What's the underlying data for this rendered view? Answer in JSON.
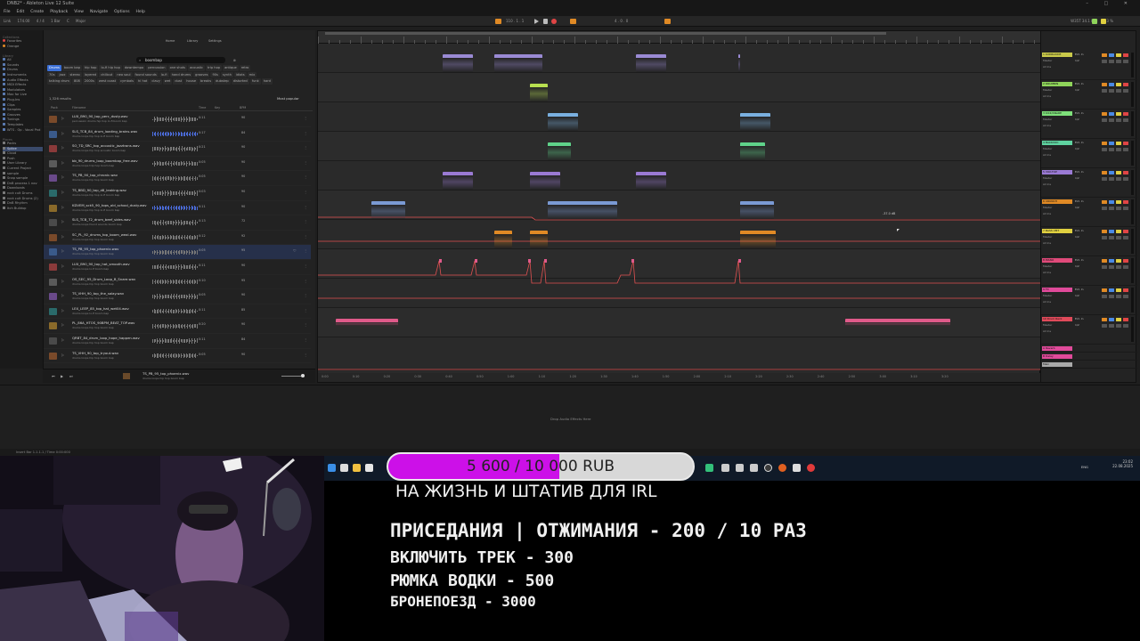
{
  "window": {
    "title": "DNB2* - Ableton Live 12 Suite",
    "controls": [
      "–",
      "□",
      "✕"
    ]
  },
  "menu": [
    "File",
    "Edit",
    "Create",
    "Playback",
    "View",
    "Navigate",
    "Options",
    "Help"
  ],
  "controlbar": {
    "link": "Link",
    "tempo": "174.00",
    "signature": "4 / 4",
    "quantize": "1 Bar",
    "key": "C",
    "scale": "Major",
    "position": "110 . 1 . 1",
    "loop_len": "4 . 0 . 0",
    "cpu": "W35T  34.1 kHz",
    "cpu_pct": "13 %"
  },
  "leftnav": {
    "collections_head": "Collections",
    "collections": [
      {
        "label": "Favorites",
        "color": "#e04545"
      },
      {
        "label": "Orange",
        "color": "#e08a25"
      }
    ],
    "library_head": "Library",
    "library": [
      "All",
      "Sounds",
      "Drums",
      "Instruments",
      "Audio Effects",
      "MIDI Effects",
      "Modulators",
      "Max for Live",
      "Plug-Ins",
      "Clips",
      "Samples",
      "Grooves",
      "Tunings",
      "Templates",
      "WTS . Op . Vocal Pnd"
    ],
    "places_head": "Places",
    "places": [
      "Packs",
      "Splice",
      "Cloud",
      "Push",
      "User Library",
      "Current Project",
      "sample",
      "Snap sample",
      "DnB process 1 nov",
      "Downloads",
      "rock cult Drums",
      "rock cult Drums (2)",
      "DnB Rhythm",
      "Itch Buildup"
    ],
    "selected_place": "Splice"
  },
  "browser": {
    "icons": [
      "Home",
      "Library",
      "Settings"
    ],
    "search_value": "boombap",
    "tags_row1": [
      "Drums",
      "boom bap",
      "hip hop",
      "lo-fi hip hop",
      "downtempo",
      "percussion",
      "one shots",
      "acoustic",
      "trip hop",
      "antique",
      "retro"
    ],
    "tags_row2": [
      "70s",
      "jazz",
      "stereo",
      "layered",
      "chillout",
      "neo soul",
      "found sounds",
      "lo-fi",
      "hand drums",
      "grooves",
      "90s",
      "synth",
      "idiots",
      "mix"
    ],
    "tags_row3": [
      "talking drum",
      "808",
      "2000s",
      "west coast",
      "cymbals",
      "hi hat",
      "clavy",
      "wet",
      "dust",
      "house",
      "breaks",
      "dubstep",
      "distorted",
      "funk",
      "hard"
    ],
    "selected_tag": "Drums",
    "results": "1,326 results",
    "sort": "Most popular",
    "columns": {
      "pack": "Pack",
      "filename": "Filename",
      "time": "Time",
      "key": "Key",
      "bpm": "BPM"
    },
    "files": [
      {
        "name": "LUX_B90_90_top_perc_dusty.wav",
        "tags": "percussion  drums  hip hop  lo-fi  boom bap",
        "time": "0:11",
        "bpm": "90"
      },
      {
        "name": "SLS_TCB_84_drum_loading_brains.wav",
        "tags": "drums  loops  hip hop  lo-fi  boom bap",
        "time": "0:17",
        "bpm": "84"
      },
      {
        "name": "SO_TD_SRC_top_acoustic_jazztrans.wav",
        "tags": "drums  loops  hip hop  acoustic  boom bap",
        "time": "0:21",
        "bpm": "90"
      },
      {
        "name": "bb_90_drums_loop_boombap_free.wav",
        "tags": "drums  loops  trip hop  boom bap",
        "time": "0:05",
        "bpm": "90"
      },
      {
        "name": "TS_PB_90_top_chronic.wav",
        "tags": "drums  loops  hip hop  boom bap",
        "time": "0:05",
        "bpm": "90"
      },
      {
        "name": "TS_BBD_90_top_d8_leaking.wav",
        "tags": "drums  loops  hip hop  lo-fi  boom bap",
        "time": "0:03",
        "bpm": "90"
      },
      {
        "name": "KDVEM_sck5_90_tops_old_school_dusty.wav",
        "tags": "drums  loops  hip hop  lo-fi  boom bap",
        "time": "0:11",
        "bpm": "90"
      },
      {
        "name": "SLS_TCB_72_drum_beef_sides.wav",
        "tags": "drums  loops  found sounds  boom bap",
        "time": "0:13",
        "bpm": "72"
      },
      {
        "name": "SC_PL_92_drums_top_boom_weal.wav",
        "tags": "drums  loops  hip hop  boom bap",
        "time": "0:12",
        "bpm": "92"
      },
      {
        "name": "TS_PB_95_top_phoenix.wav",
        "tags": "drums  loops  hip hop  boom bap",
        "time": "0:05",
        "bpm": "95"
      },
      {
        "name": "LUX_B90_90_top_hat_smooth.wav",
        "tags": "drums  loops  lo-fi  boom bap",
        "time": "0:11",
        "bpm": "90"
      },
      {
        "name": "OS_SEC_95_Drum_Loop_B_Snare.wav",
        "tags": "drums  loops  hip hop  boom bap",
        "time": "0:10",
        "bpm": "95"
      },
      {
        "name": "TS_VHH_90_top_the_salay.wav",
        "tags": "drums  loops  hip hop  boom bap",
        "time": "0:05",
        "bpm": "90"
      },
      {
        "name": "LEX_LEEP_85_top_hat_wet04.wav",
        "tags": "drums  loops  lo-fi  boom bap",
        "time": "0:11",
        "bpm": "85"
      },
      {
        "name": "PL_86A_HTOS_90BPM_BEAT_TOP.wav",
        "tags": "drums  loops  hip hop  boom bap",
        "time": "0:20",
        "bpm": "90"
      },
      {
        "name": "QRBT_84_drum_loop_hope_happen.wav",
        "tags": "drums  loops  hip hop  boom bap",
        "time": "0:11",
        "bpm": "84"
      },
      {
        "name": "TS_VHH_90_top_tryout.wav",
        "tags": "drums  loops  hip hop  boom bap",
        "time": "0:05",
        "bpm": "90"
      }
    ],
    "selected_file_index": 9,
    "preview_name": "TS_PB_95_top_phoenix.wav",
    "preview_tags": "drums  loops  hip hop  boom bap"
  },
  "arrangement": {
    "timeline": [
      "0:00",
      "0:10",
      "0:20",
      "0:30",
      "0:40",
      "0:50",
      "1:00",
      "1:10",
      "1:20",
      "1:30",
      "1:40",
      "1:50",
      "2:00",
      "2:10",
      "2:20",
      "2:30",
      "2:40",
      "2:50",
      "3:00",
      "3:10",
      "3:20"
    ],
    "automation_label": "-37.0 dB"
  },
  "mixer": {
    "tracks": [
      {
        "name": "1 KUDRIAVDE",
        "color": "#c9c94a",
        "input": "Ext. In",
        "mon": "All Ins",
        "out": "Master",
        "send": "1/2"
      },
      {
        "name": "2 DRUMBIN",
        "color": "#8fd45a",
        "input": "Ext. In",
        "mon": "All Ins",
        "out": "Master",
        "send": "1/2"
      },
      {
        "name": "3 KICK/SNARE",
        "color": "#7ee07a",
        "input": "Ext. In",
        "mon": "All Ins",
        "out": "Master",
        "send": "1/2"
      },
      {
        "name": "4 BACKVOC",
        "color": "#5fd3a0",
        "input": "Ext. In",
        "mon": "All Ins",
        "out": "Master",
        "send": "1/2"
      },
      {
        "name": "5 VOX-TOP",
        "color": "#9a7ad4",
        "input": "Ext. In",
        "mon": "All Ins",
        "out": "Master",
        "send": "1/2"
      },
      {
        "name": "6 CRUNCH",
        "color": "#e08a25",
        "input": "Ext. In",
        "mon": "All Ins",
        "out": "Master",
        "send": "1/2"
      },
      {
        "name": "7 BASS VMT",
        "color": "#e0d040",
        "input": "Ext. In",
        "mon": "All Ins",
        "out": "Master",
        "send": "1/2"
      },
      {
        "name": "8 PIANO",
        "color": "#e04a7a",
        "input": "Ext. In",
        "mon": "All Ins",
        "out": "Master",
        "send": "1/2"
      },
      {
        "name": "9 FX",
        "color": "#e04a9a",
        "input": "Ext. In",
        "mon": "All Ins",
        "out": "Master",
        "send": "1/2"
      },
      {
        "name": "10 Drum Rack",
        "color": "#e04a5a",
        "input": "Ext. In",
        "mon": "All Ins",
        "out": "Master",
        "send": "1/2"
      }
    ],
    "returns": [
      "A Reverb",
      "B Delay",
      "Main"
    ]
  },
  "device_view": {
    "drop_message": "Drop Audio Effects Here"
  },
  "statusbar": "Insert Bar 1.1.1.1 / Time 0:00:000",
  "taskbar": {
    "time": "23:02",
    "date": "22.08.2025",
    "lang": "ENG"
  },
  "overlay": {
    "goal": {
      "text": "5 600 / 10 000 RUB",
      "current": 5600,
      "target": 10000,
      "fill_color": "#cc10e8",
      "caption": "НА ЖИЗНЬ И ШТАТИВ ДЛЯ IRL"
    },
    "offers": [
      "ПРИСЕДАНИЯ | ОТЖИМАНИЯ - 200 / 10 РАЗ",
      "ВКЛЮЧИТЬ ТРЕК - 300",
      "РЮМКА ВОДКИ - 500",
      "БРОНЕПОЕЗД - 3000"
    ]
  }
}
